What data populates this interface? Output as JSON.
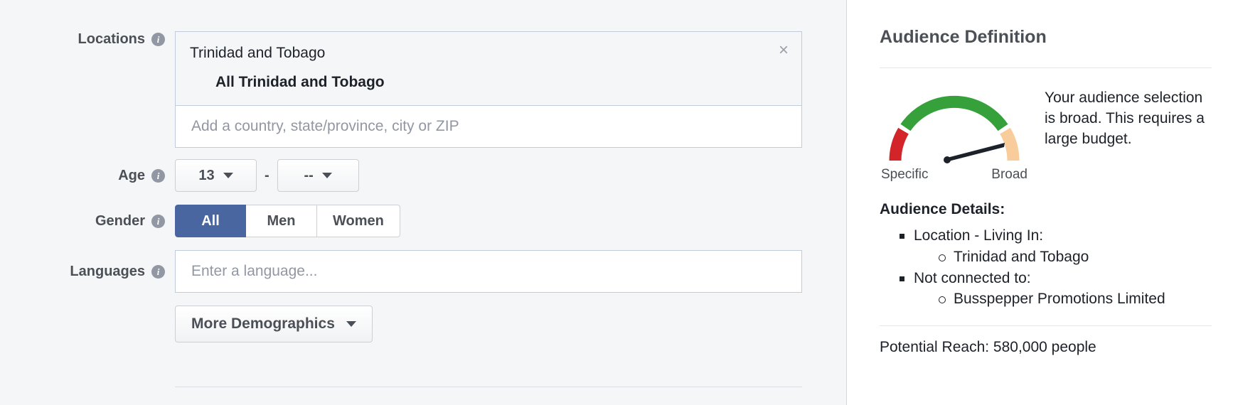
{
  "form": {
    "locations": {
      "label": "Locations",
      "chip_title": "Trinidad and Tobago",
      "chip_sub": "All Trinidad and Tobago",
      "close_glyph": "×",
      "placeholder": "Add a country, state/province, city or ZIP",
      "value": ""
    },
    "age": {
      "label": "Age",
      "min_value": "13",
      "max_value": "--",
      "separator": "-"
    },
    "gender": {
      "label": "Gender",
      "options": [
        {
          "label": "All",
          "selected": true
        },
        {
          "label": "Men",
          "selected": false
        },
        {
          "label": "Women",
          "selected": false
        }
      ]
    },
    "languages": {
      "label": "Languages",
      "placeholder": "Enter a language...",
      "value": ""
    },
    "more_demographics": {
      "label": "More Demographics"
    }
  },
  "audience_panel": {
    "title": "Audience Definition",
    "gauge": {
      "label_left": "Specific",
      "label_right": "Broad",
      "color_specific": "#d3242a",
      "color_middle": "#36a13b",
      "color_broad": "#f9cd9b",
      "needle_color": "#1d2129",
      "needle_points_to": "Broad"
    },
    "message": "Your audience selection is broad. This requires a large budget.",
    "details_title": "Audience Details:",
    "details": [
      {
        "label": "Location - Living In:",
        "children": [
          "Trinidad and Tobago"
        ]
      },
      {
        "label": "Not connected to:",
        "children": [
          "Busspepper Promotions Limited"
        ]
      }
    ],
    "potential_reach": "Potential Reach: 580,000 people"
  }
}
